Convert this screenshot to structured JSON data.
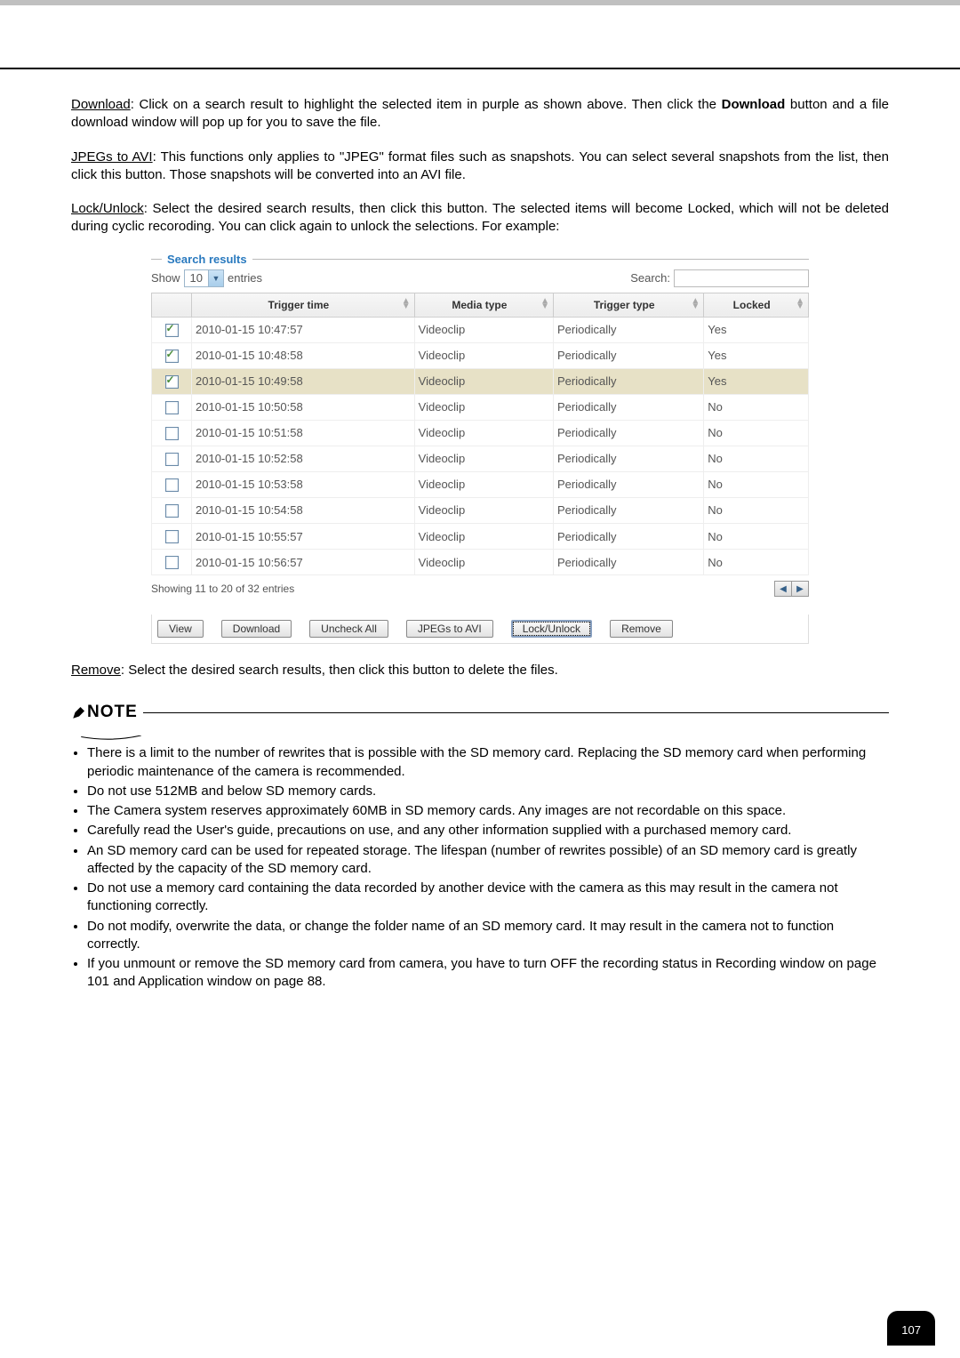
{
  "paragraphs": {
    "download_lead": "Download",
    "download_rest": ": Click on a search result to highlight the selected item in purple as shown above. Then click the ",
    "download_bold": "Download",
    "download_rest2": " button and a file download window will pop up for you to save the file.",
    "jpegs_lead": "JPEGs to AVI",
    "jpegs_rest": ": This functions only applies to \"JPEG\" format files such as snapshots. You can select several snapshots from the list, then click this button. Those snapshots will be converted into an AVI file.",
    "lock_lead": "Lock/Unlock",
    "lock_rest": ": Select the desired search results, then click this button. The selected items will become Locked, which will not be deleted during cyclic recoroding. You can click again to unlock the selections. For example:",
    "remove_lead": "Remove",
    "remove_rest": ": Select the desired search results, then click this button to delete the files."
  },
  "panel": {
    "legend": "Search results",
    "show_label": "Show",
    "show_value": "10",
    "entries_label": "entries",
    "search_label": "Search:",
    "headers": [
      "",
      "Trigger time",
      "Media type",
      "Trigger type",
      "Locked"
    ],
    "rows": [
      {
        "checked": true,
        "sel": false,
        "time": "2010-01-15 10:47:57",
        "media": "Videoclip",
        "trigger": "Periodically",
        "locked": "Yes"
      },
      {
        "checked": true,
        "sel": false,
        "time": "2010-01-15 10:48:58",
        "media": "Videoclip",
        "trigger": "Periodically",
        "locked": "Yes"
      },
      {
        "checked": true,
        "sel": true,
        "time": "2010-01-15 10:49:58",
        "media": "Videoclip",
        "trigger": "Periodically",
        "locked": "Yes"
      },
      {
        "checked": false,
        "sel": false,
        "time": "2010-01-15 10:50:58",
        "media": "Videoclip",
        "trigger": "Periodically",
        "locked": "No"
      },
      {
        "checked": false,
        "sel": false,
        "time": "2010-01-15 10:51:58",
        "media": "Videoclip",
        "trigger": "Periodically",
        "locked": "No"
      },
      {
        "checked": false,
        "sel": false,
        "time": "2010-01-15 10:52:58",
        "media": "Videoclip",
        "trigger": "Periodically",
        "locked": "No"
      },
      {
        "checked": false,
        "sel": false,
        "time": "2010-01-15 10:53:58",
        "media": "Videoclip",
        "trigger": "Periodically",
        "locked": "No"
      },
      {
        "checked": false,
        "sel": false,
        "time": "2010-01-15 10:54:58",
        "media": "Videoclip",
        "trigger": "Periodically",
        "locked": "No"
      },
      {
        "checked": false,
        "sel": false,
        "time": "2010-01-15 10:55:57",
        "media": "Videoclip",
        "trigger": "Periodically",
        "locked": "No"
      },
      {
        "checked": false,
        "sel": false,
        "time": "2010-01-15 10:56:57",
        "media": "Videoclip",
        "trigger": "Periodically",
        "locked": "No"
      }
    ],
    "showing": "Showing 11 to 20 of 32 entries",
    "buttons": {
      "view": "View",
      "download": "Download",
      "uncheck_all": "Uncheck All",
      "jpegs_to_avi": "JPEGs to AVI",
      "lock_unlock": "Lock/Unlock",
      "remove": "Remove"
    }
  },
  "note": {
    "heading": "NOTE",
    "items": [
      "There is a limit to the number of rewrites that is possible with the SD memory card. Replacing the SD memory card when performing periodic maintenance of the camera is recommended.",
      "Do not use 512MB and below SD memory cards.",
      "The Camera system reserves approximately 60MB in SD memory cards. Any images are not recordable on this space.",
      "Carefully read the User's guide, precautions on use, and any other information supplied with a purchased memory card.",
      "An SD memory card can be used for repeated storage. The lifespan (number of rewrites possible) of an SD memory card is greatly affected by the capacity of the SD memory card.",
      "Do not use a memory card containing the data recorded by another device with the camera as this may result in the camera not functioning correctly.",
      "Do not modify, overwrite the data, or change the folder name of an SD memory card. It may result in the camera not to function correctly.",
      "If you unmount or remove the SD memory card from camera, you have to turn OFF the recording status in Recording window on page 101 and Application window on page 88."
    ]
  },
  "page_number": "107"
}
